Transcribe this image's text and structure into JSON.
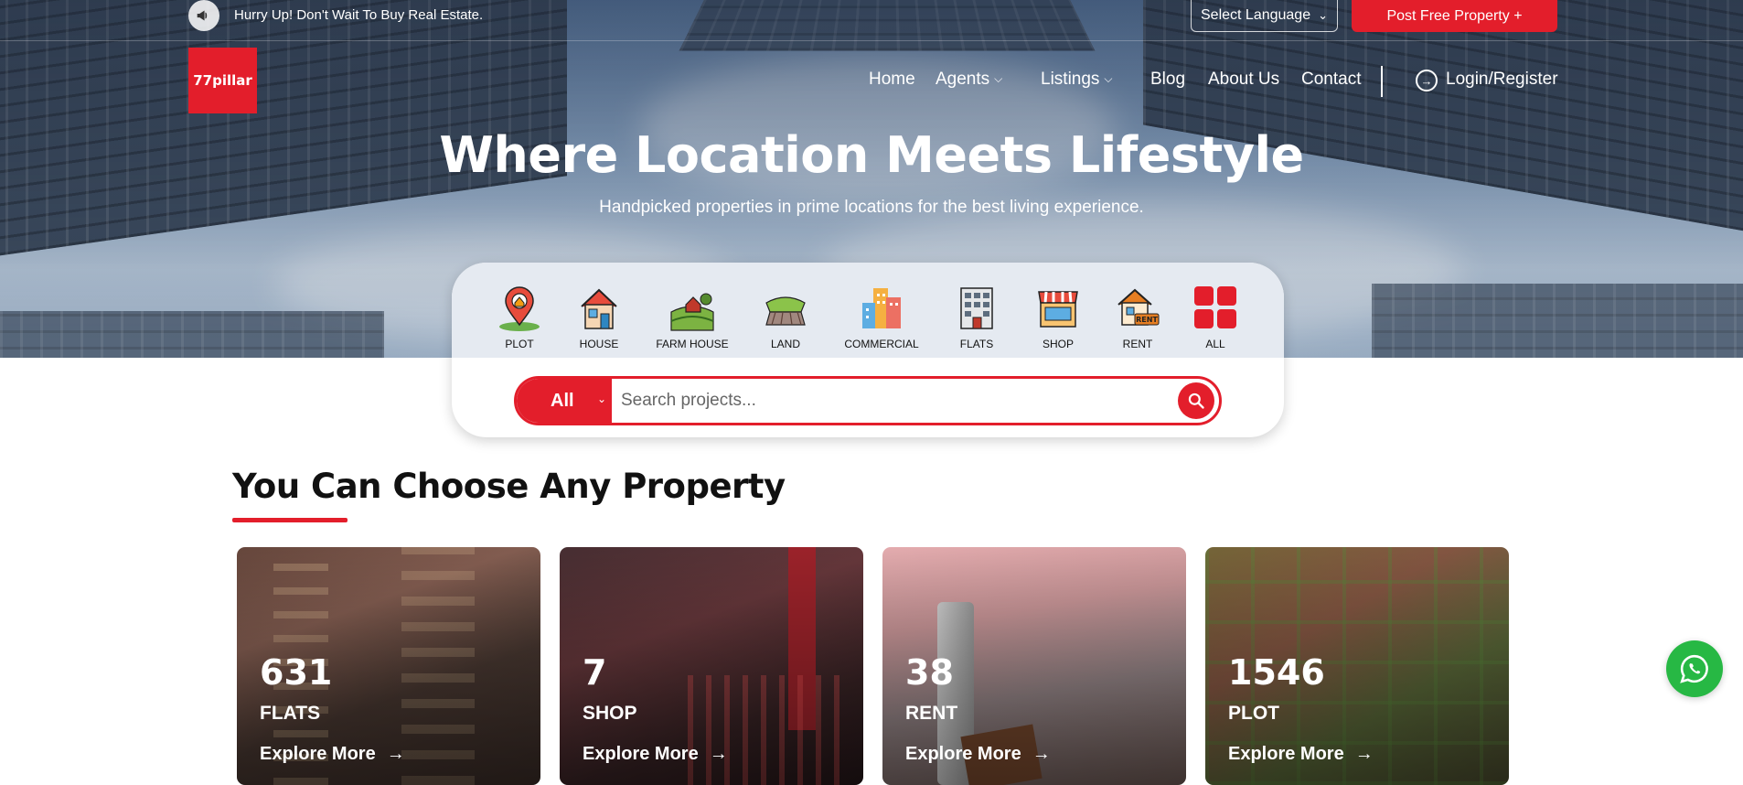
{
  "topbar": {
    "announcement": "Hurry Up! Don't Wait To Buy Real Estate.",
    "announcement_icon": "megaphone-icon",
    "language_select": "Select Language",
    "post_button": "Post Free Property +"
  },
  "brand": {
    "logo_text": "77pillar",
    "accent_color": "#e31e2b"
  },
  "nav": {
    "items": [
      {
        "label": "Home"
      },
      {
        "label": "Agents",
        "dropdown": true
      },
      {
        "label": "Listings",
        "dropdown": true
      },
      {
        "label": "Blog"
      },
      {
        "label": "About Us"
      },
      {
        "label": "Contact"
      }
    ],
    "login": "Login/Register"
  },
  "hero": {
    "title": "Where Location Meets Lifestyle",
    "subtitle": "Handpicked properties in prime locations for the best living experience."
  },
  "categories": [
    {
      "label": "PLOT",
      "icon": "plot-pin-icon"
    },
    {
      "label": "HOUSE",
      "icon": "house-icon"
    },
    {
      "label": "FARM HOUSE",
      "icon": "farm-house-icon"
    },
    {
      "label": "LAND",
      "icon": "land-icon"
    },
    {
      "label": "COMMERCIAL",
      "icon": "commercial-building-icon"
    },
    {
      "label": "FLATS",
      "icon": "flats-building-icon"
    },
    {
      "label": "SHOP",
      "icon": "shop-icon"
    },
    {
      "label": "RENT",
      "icon": "rent-house-icon"
    },
    {
      "label": "ALL",
      "icon": "grid-icon"
    }
  ],
  "search": {
    "type_selected": "All",
    "placeholder": "Search projects..."
  },
  "section": {
    "title": "You Can Choose Any Property"
  },
  "cards": [
    {
      "count": "631",
      "type": "FLATS",
      "link": "Explore More"
    },
    {
      "count": "7",
      "type": "SHOP",
      "link": "Explore More"
    },
    {
      "count": "38",
      "type": "RENT",
      "link": "Explore More"
    },
    {
      "count": "1546",
      "type": "PLOT",
      "link": "Explore More"
    }
  ],
  "floating": {
    "whatsapp_icon": "whatsapp-icon",
    "whatsapp_color": "#27b844"
  }
}
